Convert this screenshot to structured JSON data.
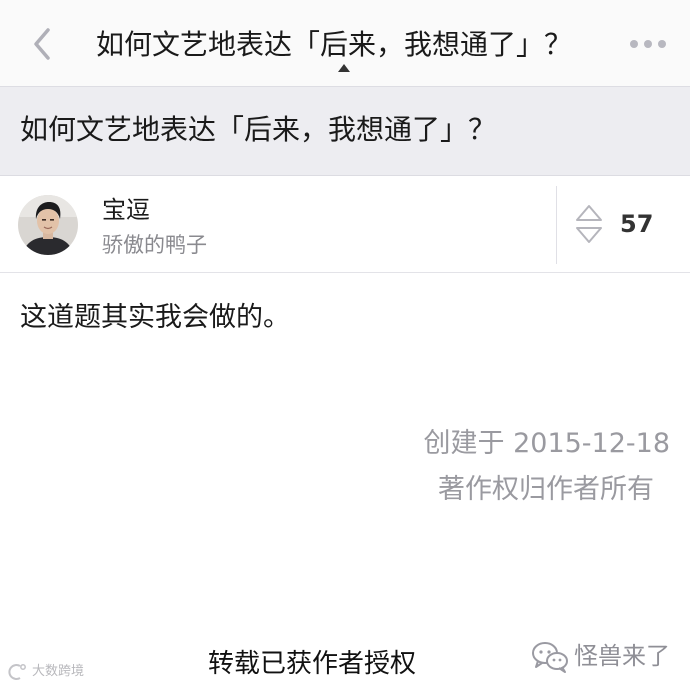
{
  "navbar": {
    "title": "如何文艺地表达「后来，我想通了」？",
    "back_icon": "chevron-left-icon",
    "more_icon": "more-dots-icon"
  },
  "question": {
    "title": "如何文艺地表达「后来，我想通了」？"
  },
  "author": {
    "name": "宝逗",
    "bio": "骄傲的鸭子",
    "votes": "57",
    "vote_icon": "vote-arrows-icon"
  },
  "answer": {
    "text": "这道题其实我会做的。",
    "created": "创建于 2015-12-18",
    "copyright": "著作权归作者所有"
  },
  "overlay": {
    "repost_caption": "转载已获作者授权",
    "watermark_left": "大数跨境",
    "watermark_right": "怪兽来了"
  },
  "colors": {
    "nav_bg": "#fafafa",
    "question_band_bg": "#ededf1",
    "muted_text": "#9a9aa0",
    "icon_gray": "#b5b5bc"
  }
}
